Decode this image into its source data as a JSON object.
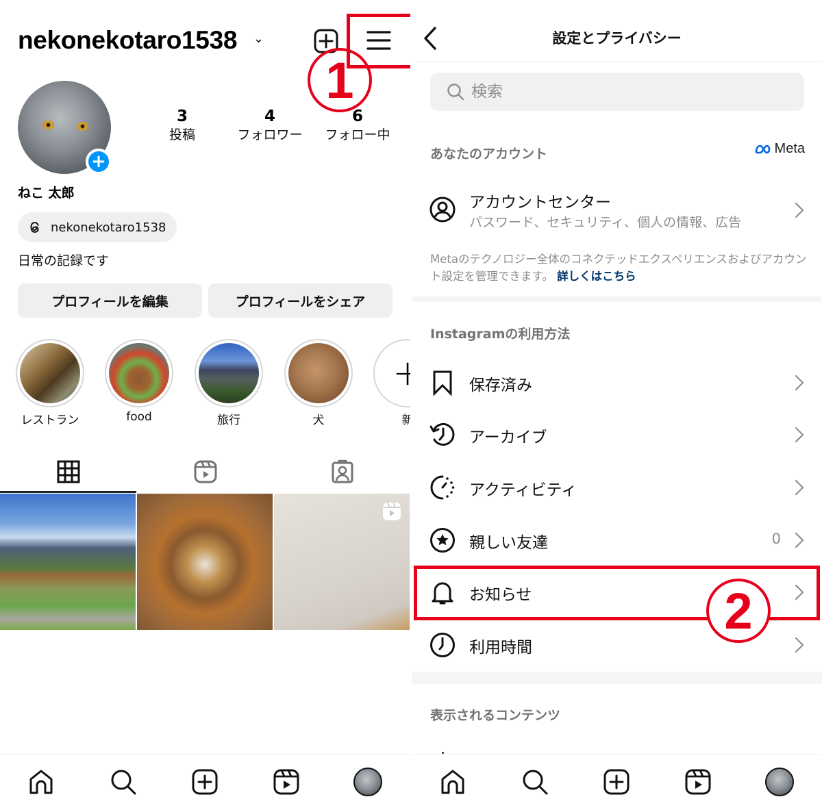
{
  "profile": {
    "username": "nekonekotaro1538",
    "stats": [
      {
        "value": "3",
        "label": "投稿"
      },
      {
        "value": "4",
        "label": "フォロワー"
      },
      {
        "value": "6",
        "label": "フォロー中"
      }
    ],
    "display_name": "ねこ 太郎",
    "threads_handle": "nekonekotaro1538",
    "bio": "日常の記録です",
    "buttons": {
      "edit": "プロフィールを編集",
      "share": "プロフィールをシェア"
    },
    "highlights": [
      {
        "label": "レストラン"
      },
      {
        "label": "food"
      },
      {
        "label": "旅行"
      },
      {
        "label": "犬"
      },
      {
        "label": "新"
      }
    ],
    "tabs": [
      "grid",
      "reels",
      "tagged"
    ],
    "active_tab": "grid",
    "posts": [
      {
        "type": "photo",
        "subject": "mountain-park"
      },
      {
        "type": "photo",
        "subject": "food-plate"
      },
      {
        "type": "reel",
        "subject": "wall-corner"
      }
    ]
  },
  "settings": {
    "title": "設定とプライバシー",
    "search_placeholder": "検索",
    "account_section": {
      "header": "あなたのアカウント",
      "meta_label": "Meta",
      "account_center": {
        "title": "アカウントセンター",
        "subtitle": "パスワード、セキュリティ、個人の情報、広告"
      },
      "description": "Metaのテクノロジー全体のコネクテッドエクスペリエンスおよびアカウント設定を管理できます。",
      "link": "詳しくはこちら"
    },
    "usage_section": {
      "header": "Instagramの利用方法",
      "items": [
        {
          "label": "保存済み",
          "icon": "bookmark-icon"
        },
        {
          "label": "アーカイブ",
          "icon": "archive-icon"
        },
        {
          "label": "アクティビティ",
          "icon": "activity-icon"
        },
        {
          "label": "親しい友達",
          "icon": "close-friends-star-icon",
          "count": "0"
        },
        {
          "label": "お知らせ",
          "icon": "bell-icon"
        },
        {
          "label": "利用時間",
          "icon": "clock-icon"
        }
      ]
    },
    "content_section": {
      "header": "表示されるコンテンツ"
    }
  },
  "annotations": {
    "step1": "1",
    "step2": "2",
    "color": "#e6001a"
  },
  "colors": {
    "accent_blue": "#0095f6",
    "link_blue": "#00376b",
    "meta_blue": "#0668e1",
    "secondary_text": "#8e8e8e"
  }
}
